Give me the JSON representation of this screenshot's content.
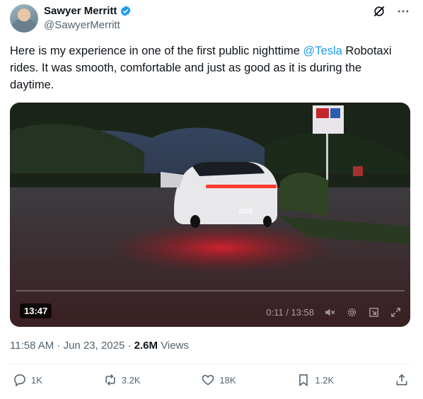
{
  "author": {
    "name": "Sawyer Merritt",
    "handle": "@SawyerMerritt"
  },
  "tweet": {
    "text_before": "Here is my experience in one of the first public nighttime ",
    "mention": "@Tesla",
    "text_after": " Robotaxi rides. It was smooth, comfortable and just as good as it is during the daytime."
  },
  "video": {
    "duration_badge": "13:47",
    "time_display": "0:11 / 13:58",
    "progress": 0.013
  },
  "meta": {
    "timestamp": "11:58 AM · Jun 23, 2025 · ",
    "views_count": "2.6M",
    "views_label": " Views"
  },
  "actions": {
    "replies": "1K",
    "reposts": "3.2K",
    "likes": "18K",
    "bookmarks": "1.2K"
  },
  "colors": {
    "accent": "#1d9bf0",
    "secondary_text": "#536471"
  },
  "icons": [
    "verified-badge-icon",
    "grok-icon",
    "more-icon",
    "mute-icon",
    "settings-icon",
    "pip-icon",
    "fullscreen-icon",
    "reply-icon",
    "repost-icon",
    "like-icon",
    "bookmark-icon",
    "share-icon"
  ]
}
